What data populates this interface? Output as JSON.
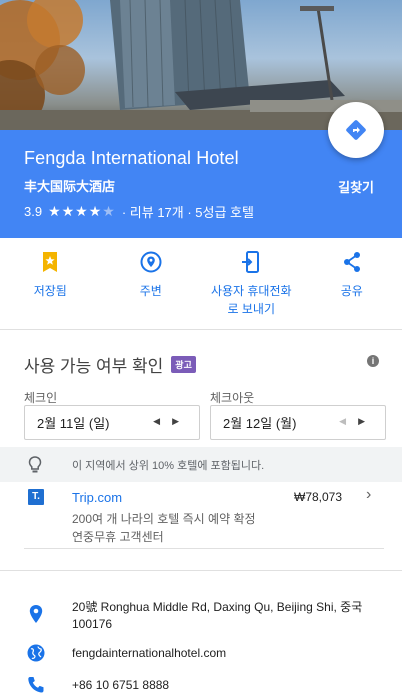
{
  "hotel": {
    "name": "Fengda International Hotel",
    "native_name": "丰大国际大酒店",
    "rating": "3.9",
    "stars_full": "★★★★",
    "stars_empty": "★",
    "reviews_text": "· 리뷰 17개 · 5성급 호텔",
    "directions_label": "길찾기"
  },
  "actions": [
    {
      "label": "저장됨",
      "icon": "bookmark-star-icon"
    },
    {
      "label": "주변",
      "icon": "nearby-pin-icon"
    },
    {
      "label": "사용자 휴대전화\n로 보내기",
      "icon": "send-to-phone-icon"
    },
    {
      "label": "공유",
      "icon": "share-icon"
    }
  ],
  "availability": {
    "title": "사용 가능 여부 확인",
    "ad_badge": "광고",
    "checkin_label": "체크인",
    "checkin_value": "2월 11일 (일)",
    "checkout_label": "체크아웃",
    "checkout_value": "2월 12일 (월)",
    "hint": "이 지역에서 상위 10% 호텔에 포함됩니다."
  },
  "offer": {
    "logo_letter": "T.",
    "provider": "Trip.com",
    "price": "₩78,073",
    "line1": "200여 개 나라의 호텔 즉시 예약 확정",
    "line2": "연중무휴 고객센터"
  },
  "info": {
    "address": "20號 Ronghua Middle Rd, Daxing Qu, Beijing Shi, 중국 100176",
    "website": "fengdainternationalhotel.com",
    "phone": "+86 10 6751 8888"
  },
  "colors": {
    "header_blue": "#4285f4",
    "accent_yellow": "#f4b400",
    "link_blue": "#1a73e8"
  }
}
